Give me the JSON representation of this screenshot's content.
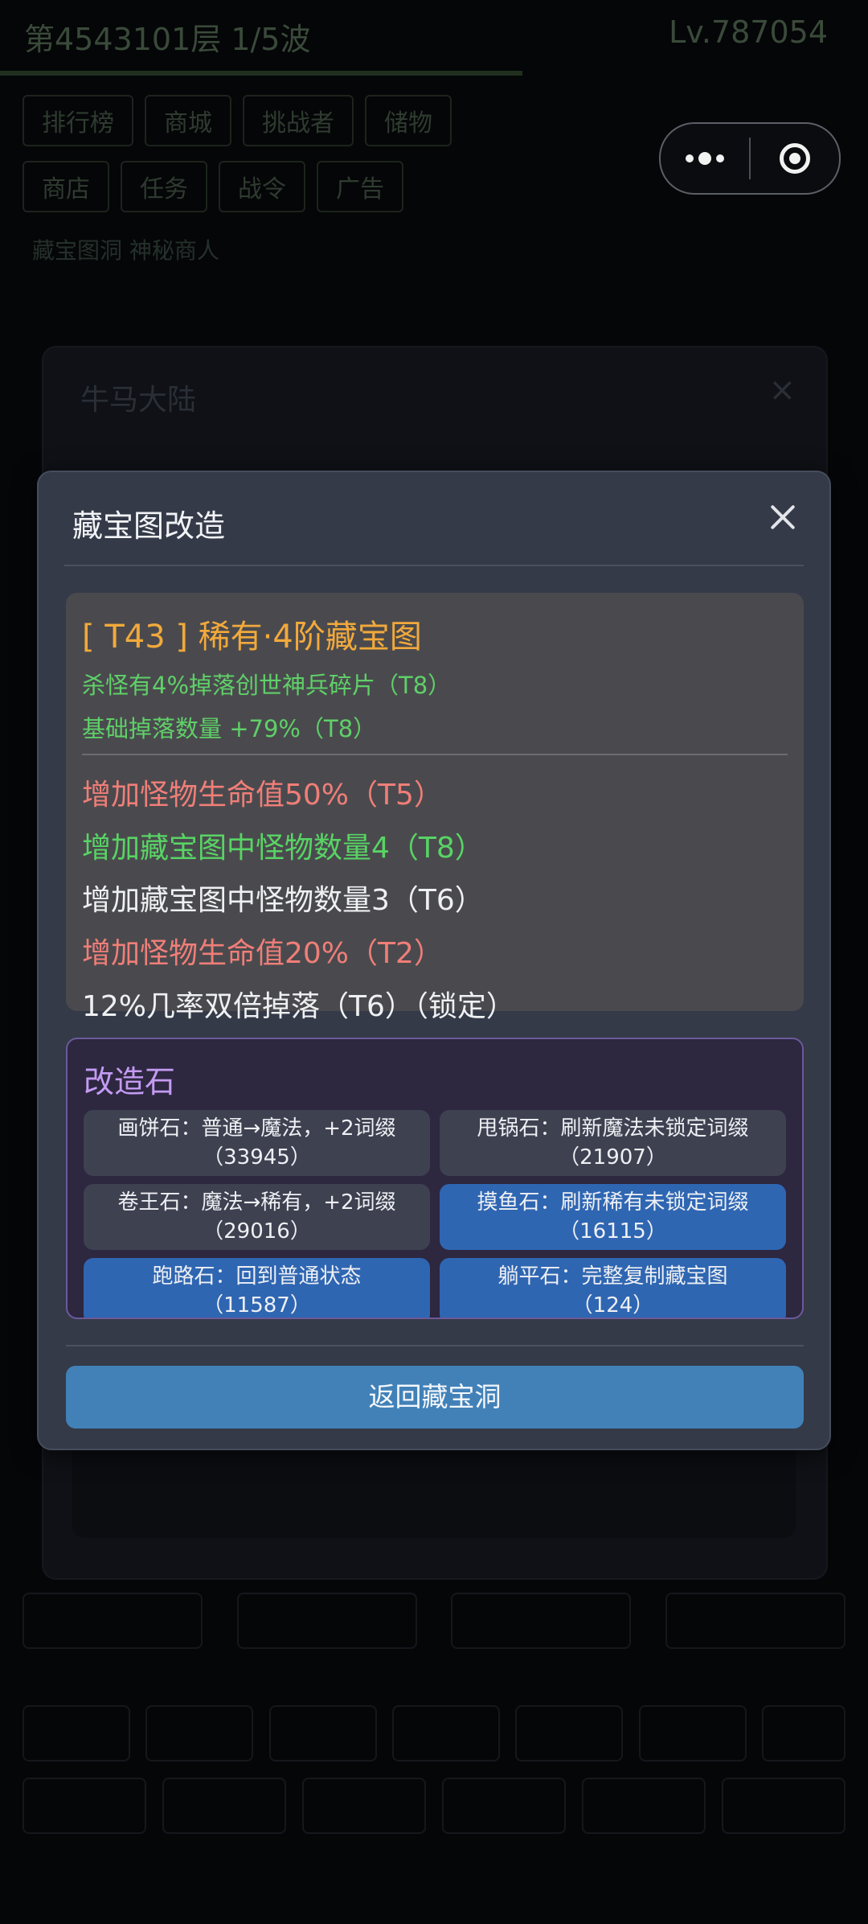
{
  "background": {
    "floor_text": "第4543101层  1/5波",
    "level_text": "Lv.787054",
    "tabs_row1": [
      "排行榜",
      "商城",
      "挑战者",
      "储物"
    ],
    "tabs_row2": [
      "商店",
      "任务",
      "战令",
      "广告"
    ],
    "row3": "藏宝图洞  神秘商人",
    "dialog_title": "牛马大陆",
    "dialog_close": "×",
    "bottom_row1": [
      "",
      "",
      "",
      ""
    ],
    "bottom_row2": [
      "",
      "",
      "",
      "",
      "",
      "",
      ""
    ],
    "bottom_row3": [
      "",
      "",
      "",
      "",
      "",
      ""
    ]
  },
  "modal": {
    "title": "藏宝图改造",
    "map": {
      "title": "[ T43 ] 稀有·4阶藏宝图",
      "implicits": [
        "杀怪有4%掉落创世神兵碎片（T8）",
        "基础掉落数量 +79%（T8）"
      ],
      "affixes": [
        {
          "text": "增加怪物生命值50%（T5）",
          "color": "red"
        },
        {
          "text": "增加藏宝图中怪物数量4（T8）",
          "color": "green"
        },
        {
          "text": "增加藏宝图中怪物数量3（T6）",
          "color": "white"
        },
        {
          "text": "增加怪物生命值20%（T2）",
          "color": "red"
        },
        {
          "text": "12%几率双倍掉落（T6）（锁定）",
          "color": "white"
        }
      ]
    },
    "stones": {
      "title": "改造石",
      "items": [
        {
          "line1": "画饼石：普通→魔法，+2词缀",
          "line2": "（33945）",
          "active": false
        },
        {
          "line1": "甩锅石：刷新魔法未锁定词缀",
          "line2": "（21907）",
          "active": false
        },
        {
          "line1": "卷王石：魔法→稀有，+2词缀",
          "line2": "（29016）",
          "active": false
        },
        {
          "line1": "摸鱼石：刷新稀有未锁定词缀",
          "line2": "（16115）",
          "active": true
        },
        {
          "line1": "跑路石：回到普通状态",
          "line2": "（11587）",
          "active": true
        },
        {
          "line1": "躺平石：完整复制藏宝图",
          "line2": "（124）",
          "active": true
        }
      ]
    },
    "return_label": "返回藏宝洞"
  },
  "colors": {
    "modal_bg": "#343a48",
    "title_orange": "#f2a93b",
    "affix_red": "#f07e78",
    "affix_green": "#58d464",
    "stone_title": "#c49bf2",
    "active_blue": "#2f66b2",
    "return_blue": "#4281b8"
  }
}
